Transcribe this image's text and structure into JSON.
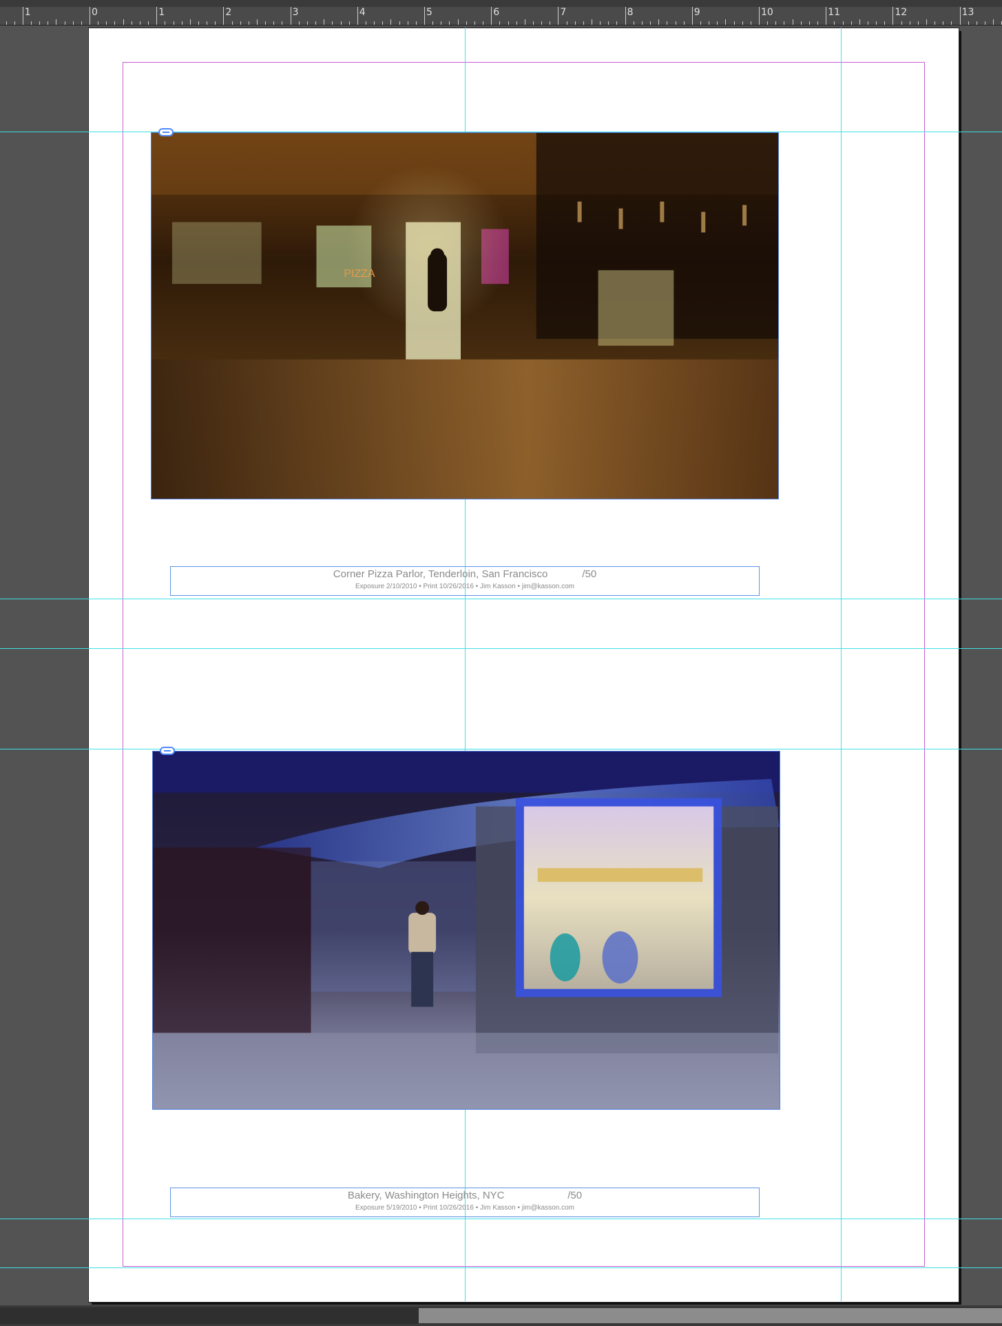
{
  "ruler": {
    "labels": [
      "1",
      "0",
      "1",
      "2",
      "3",
      "4",
      "5",
      "6",
      "7",
      "8",
      "9",
      "10",
      "11",
      "12",
      "13"
    ]
  },
  "photos": [
    {
      "name": "corner-pizza-photo",
      "palette": [
        "#f0b35e",
        "#3a2208",
        "#1b0f04"
      ]
    },
    {
      "name": "bakery-photo",
      "palette": [
        "#9ab0e8",
        "#3345a8",
        "#1a1530"
      ]
    }
  ],
  "captions": [
    {
      "title": "Corner Pizza Parlor, Tenderloin, San Francisco            /50",
      "subtitle": "Exposure 2/10/2010 • Print 10/26/2016 • Jim Kasson • jim@kasson.com"
    },
    {
      "title": "Bakery, Washington Heights, NYC                      /50",
      "subtitle": "Exposure 5/19/2010 • Print 10/26/2016 • Jim Kasson • jim@kasson.com"
    }
  ],
  "colors": {
    "guide": "#3fe0e6",
    "margin": "#c65bd3",
    "frame": "#4f7fe0"
  }
}
